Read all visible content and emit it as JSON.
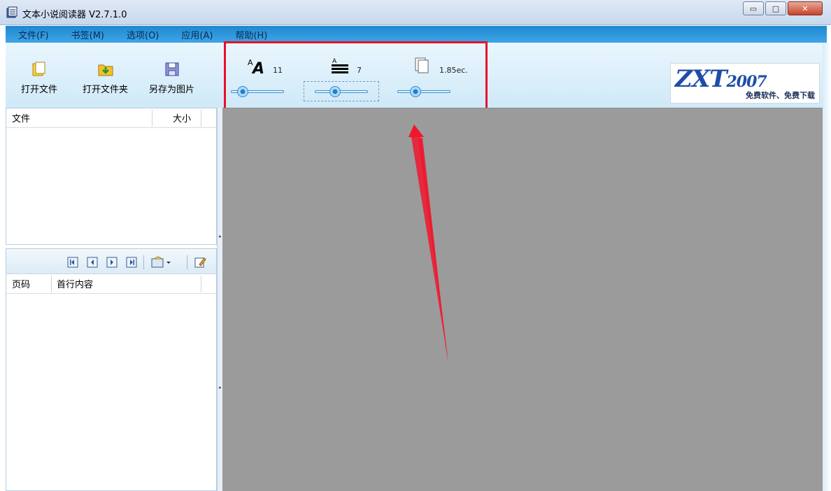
{
  "window": {
    "title": "文本小说阅读器 V2.7.1.0",
    "minimize_label": "▭",
    "maximize_label": "□",
    "close_label": "✕"
  },
  "menu": {
    "items": [
      {
        "label": "文件(F)"
      },
      {
        "label": "书签(M)"
      },
      {
        "label": "选项(O)"
      },
      {
        "label": "应用(A)"
      },
      {
        "label": "帮助(H)"
      }
    ]
  },
  "toolbar": {
    "open_file": "打开文件",
    "open_folder": "打开文件夹",
    "save_as_image": "另存为图片"
  },
  "controls": {
    "font_size": {
      "value": "11",
      "icon": "font-size-icon",
      "slider_level": 0.15
    },
    "line_spacing": {
      "value": "7",
      "icon": "line-spacing-icon",
      "slider_level": 0.35
    },
    "page_interval": {
      "value": "1.85ec.",
      "icon": "page-interval-icon",
      "slider_level": 0.3
    }
  },
  "logo": {
    "brand": "ZXT",
    "year": "2007",
    "tagline": "免费软件、免费下载"
  },
  "file_list": {
    "columns": [
      "文件",
      "大小"
    ]
  },
  "bookmarks": {
    "columns": [
      "页码",
      "首行内容"
    ],
    "tool_icons": [
      "first-page-icon",
      "prev-page-icon",
      "next-page-icon",
      "last-page-icon",
      "bookmark-menu-icon",
      "edit-icon"
    ]
  },
  "colors": {
    "menubar": "#2a97dc",
    "highlight_frame": "#e8102a",
    "content_bg": "#9b9b9b"
  }
}
